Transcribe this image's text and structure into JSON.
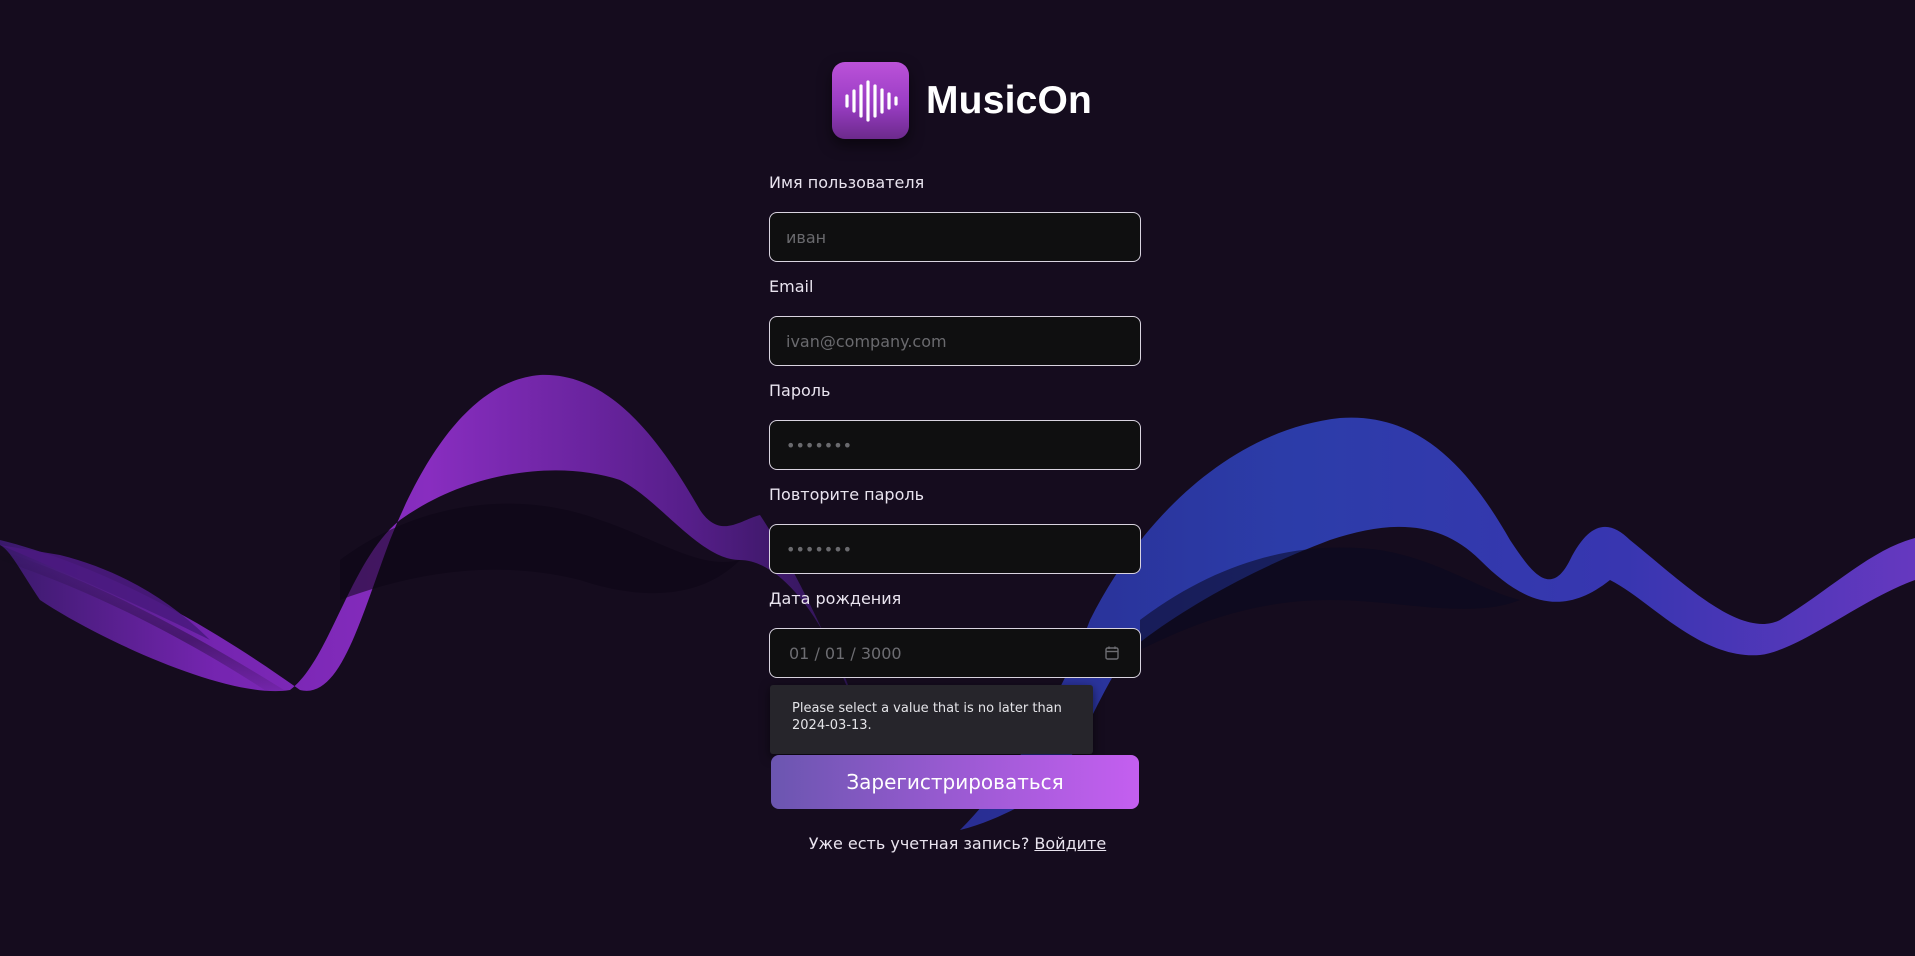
{
  "brand": {
    "name": "MusicOn",
    "icon": "soundwave-icon"
  },
  "form": {
    "username": {
      "label": "Имя пользователя",
      "placeholder": "иван",
      "value": ""
    },
    "email": {
      "label": "Email",
      "placeholder": "ivan@company.com",
      "value": ""
    },
    "password": {
      "label": "Пароль",
      "placeholder": "•••••••",
      "value": ""
    },
    "confirm_password": {
      "label": "Повторите пароль",
      "placeholder": "•••••••",
      "value": ""
    },
    "birthdate": {
      "label": "Дата рождения",
      "value": "01 / 01 / 3000",
      "icon": "calendar-icon"
    },
    "validation_tooltip": "Please select a value that is no later than 2024-03-13.",
    "submit_label": "Зарегистрироваться"
  },
  "footer": {
    "prompt": "Уже есть учетная запись?",
    "login_link": "Войдите"
  },
  "colors": {
    "background": "#150c1e",
    "accent_start": "#6b56b0",
    "accent_end": "#c45ff0",
    "wave_purple": "#8a2bc2",
    "wave_blue": "#2a3aa8"
  }
}
